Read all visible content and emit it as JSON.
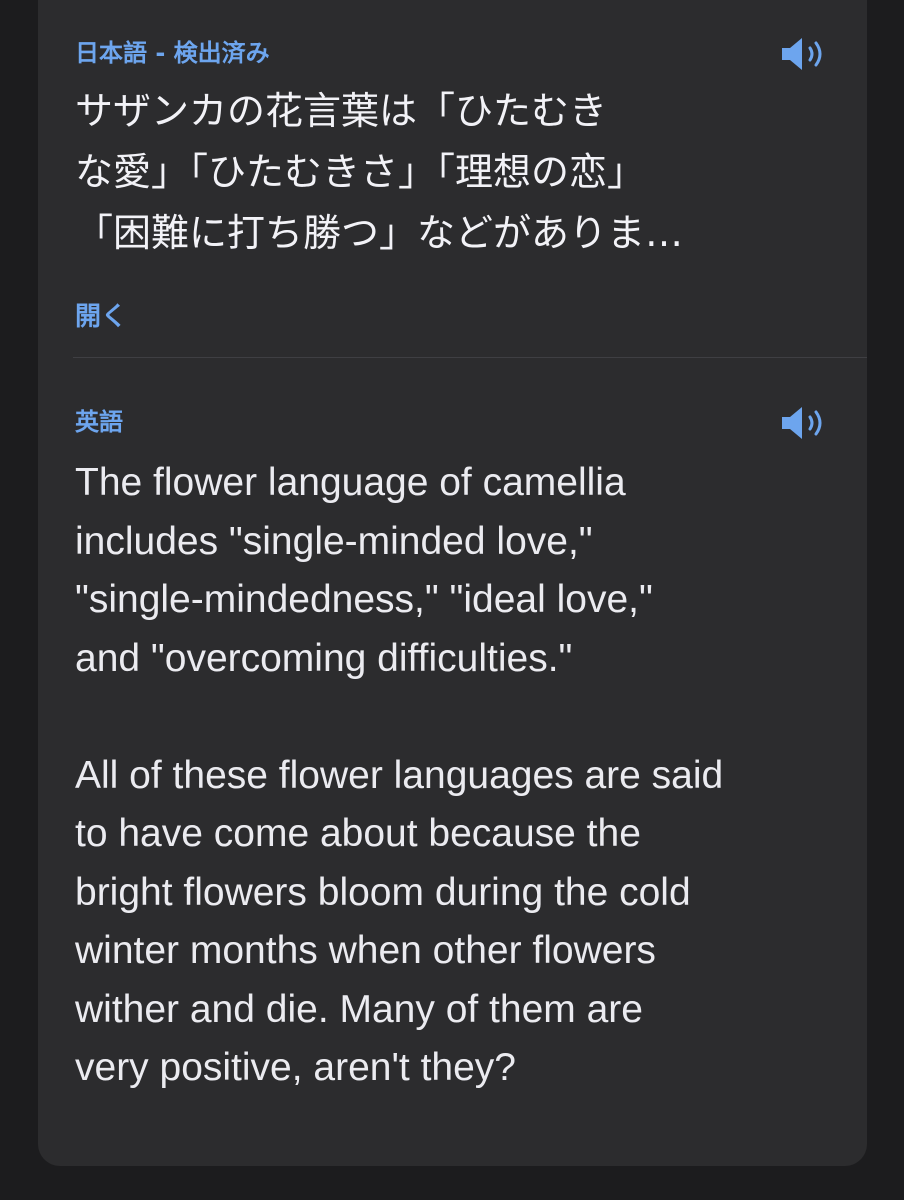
{
  "source": {
    "language_label": "日本語 - 検出済み",
    "speaker_icon": "speaker-icon",
    "text_lines": [
      "サザンカの花言葉は「ひたむき",
      "な愛」「ひたむきさ」「理想の恋」",
      "「困難に打ち勝つ」などがありま…"
    ],
    "open_label": "開く"
  },
  "target": {
    "language_label": "英語",
    "speaker_icon": "speaker-icon",
    "paragraph1_lines": [
      "The flower language of camellia",
      "includes \"single-minded love,\"",
      "\"single-mindedness,\" \"ideal love,\"",
      "and \"overcoming difficulties.\""
    ],
    "paragraph2_lines": [
      "All of these flower languages are said",
      "to have come about because the",
      "bright flowers bloom during the cold",
      "winter months when other flowers",
      "wither and die. Many of them are",
      "very positive, aren't they?"
    ]
  },
  "colors": {
    "background": "#1c1c1e",
    "card": "#2c2c2e",
    "accent": "#6da5ee",
    "text": "#f2f2f7"
  }
}
